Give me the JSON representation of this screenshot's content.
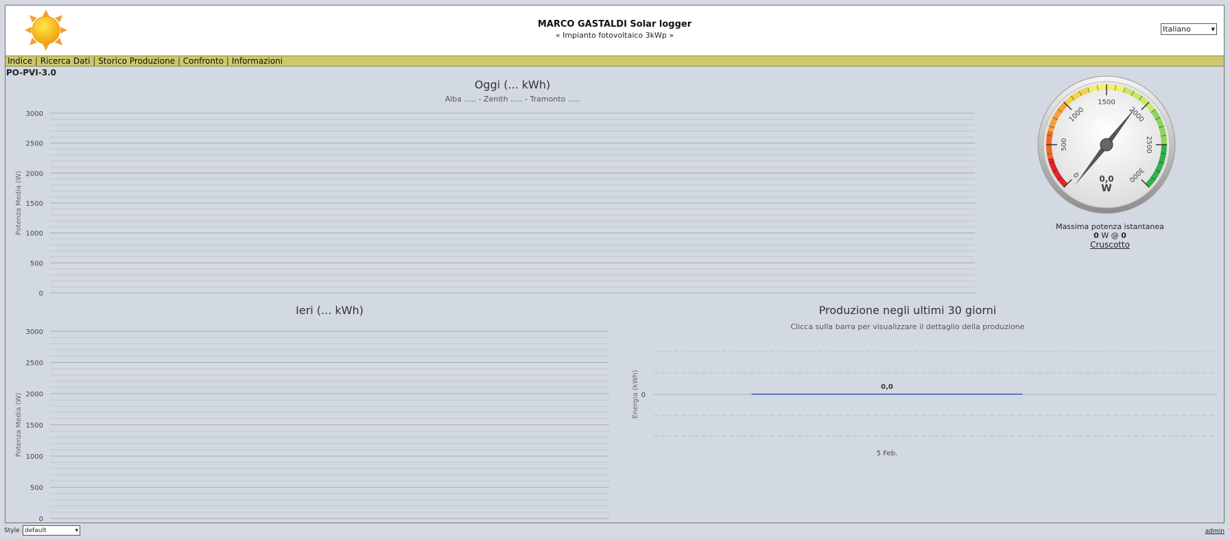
{
  "header": {
    "title": "MARCO GASTALDI Solar logger",
    "subtitle": "« Impianto fotovoltaico 3kWp »",
    "language": "Italiano"
  },
  "nav": {
    "items": [
      "Indice",
      "Ricerca Dati",
      "Storico Produzione",
      "Confronto",
      "Informazioni"
    ]
  },
  "device": "PO-PVI-3.0",
  "gauge": {
    "value_label": "0,0",
    "unit": "W",
    "ticks": [
      "0",
      "500",
      "1000",
      "1500",
      "2000",
      "2500",
      "3000"
    ],
    "max_label": "Massima potenza istantanea",
    "max_value": "0",
    "max_unit": "W @",
    "max_time": "0",
    "link": "Cruscotto"
  },
  "footer": {
    "style_label": "Style :",
    "style_value": "default",
    "admin": "admin"
  },
  "chart_data": [
    {
      "type": "line",
      "title": "Oggi (... kWh)",
      "subtitle": "Alba ..... - Zenith ..... - Tramonto .....",
      "ylabel": "Potenza Media (W)",
      "yticks": [
        "3000",
        "2500",
        "2000",
        "1500",
        "1000",
        "500",
        "0"
      ],
      "ylim": [
        0,
        3000
      ],
      "series": []
    },
    {
      "type": "line",
      "title": "Ieri (... kWh)",
      "ylabel": "Potenza Media (W)",
      "yticks": [
        "3000",
        "2500",
        "2000",
        "1500",
        "1000",
        "500",
        "0"
      ],
      "ylim": [
        0,
        3000
      ],
      "series": []
    },
    {
      "type": "bar",
      "title": "Produzione negli ultimi 30 giorni",
      "subtitle": "Clicca sulla barra per visualizzare il dettaglio della produzione",
      "ylabel": "Energia (kWh)",
      "categories": [
        "5 Feb."
      ],
      "values": [
        0.0
      ],
      "value_labels": [
        "0,0"
      ],
      "yticks": [
        "0"
      ]
    }
  ],
  "colors": {
    "nav_bg": "#cdc96a",
    "page_bg": "#d3d9e2",
    "bar": "#2b5fb0"
  }
}
